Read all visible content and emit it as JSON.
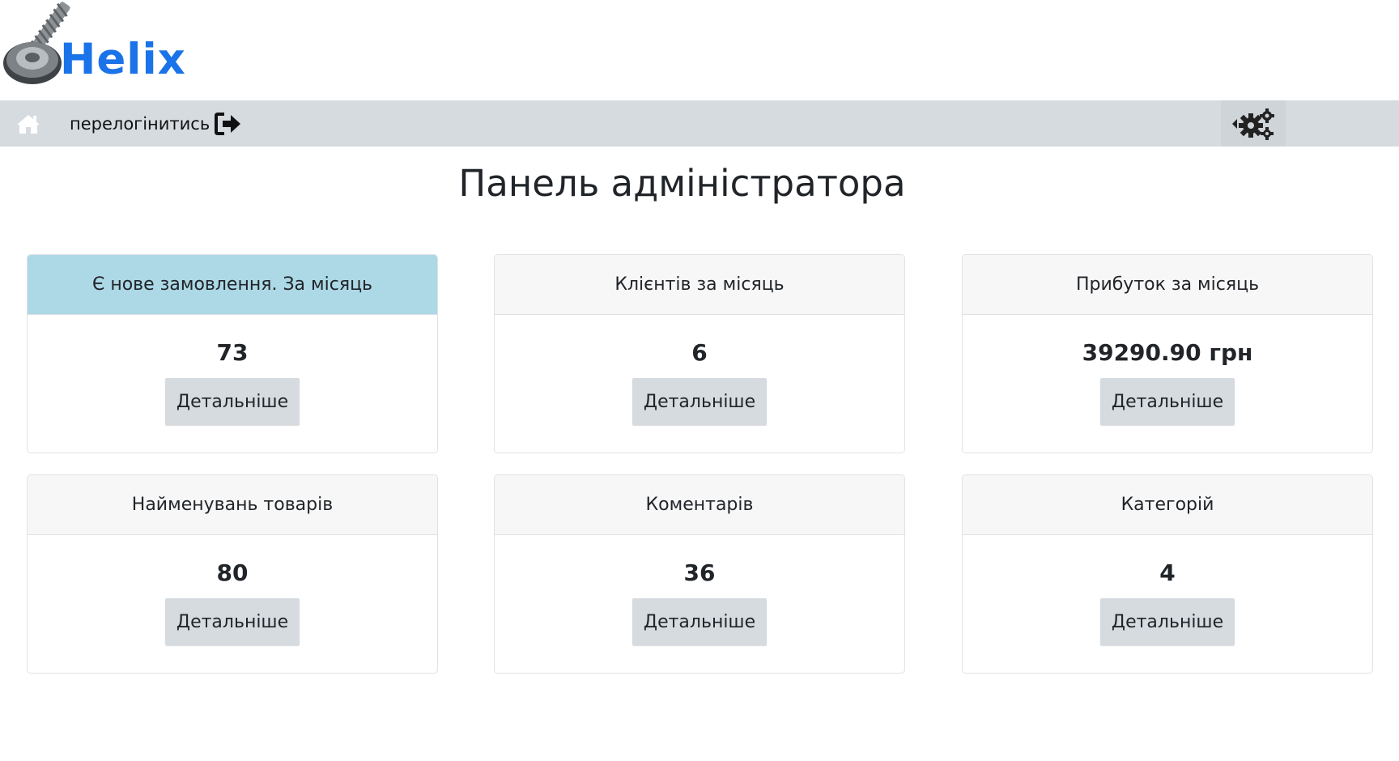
{
  "brand": {
    "name": "Helix",
    "color": "#1a73e8"
  },
  "navbar": {
    "home_icon": "home-icon",
    "relogin_label": "перелогінитись",
    "exit_icon": "sign-out-icon",
    "settings_icon": "gears-icon"
  },
  "page_title": "Панель адміністратора",
  "cards": [
    {
      "title": "Є нове замовлення. За місяць",
      "value": "73",
      "button": "Детальніше",
      "highlight": true
    },
    {
      "title": "Клієнтів за місяць",
      "value": "6",
      "button": "Детальніше",
      "highlight": false
    },
    {
      "title": "Прибуток за місяць",
      "value": "39290.90 грн",
      "button": "Детальніше",
      "highlight": false
    },
    {
      "title": "Найменувань товарів",
      "value": "80",
      "button": "Детальніше",
      "highlight": false
    },
    {
      "title": "Коментарів",
      "value": "36",
      "button": "Детальніше",
      "highlight": false
    },
    {
      "title": "Категорій",
      "value": "4",
      "button": "Детальніше",
      "highlight": false
    }
  ],
  "colors": {
    "navbar_bg": "#d6dbe0",
    "highlight_header": "#add8e6",
    "card_header_bg": "#f7f7f7"
  }
}
